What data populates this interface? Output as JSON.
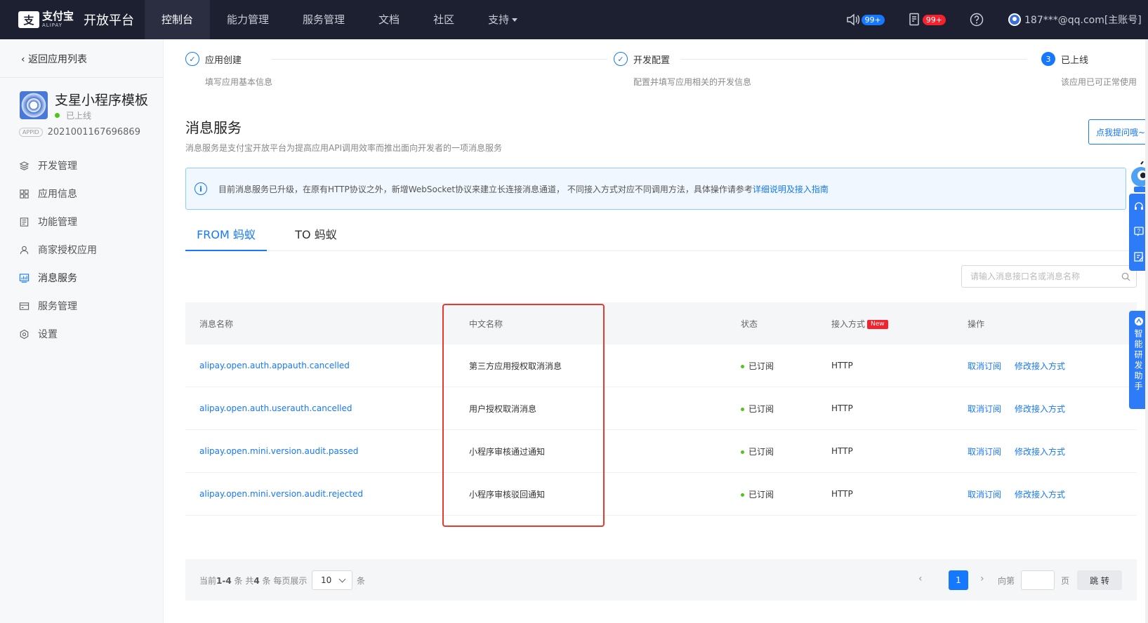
{
  "header": {
    "logo_mark": "支",
    "logo_cn": "支付宝",
    "logo_en": "ALIPAY",
    "platform_title": "开放平台",
    "nav": [
      {
        "label": "控制台",
        "active": true
      },
      {
        "label": "能力管理"
      },
      {
        "label": "服务管理"
      },
      {
        "label": "文档"
      },
      {
        "label": "社区"
      },
      {
        "label": "支持"
      }
    ],
    "notice_badge": "99+",
    "message_badge": "99+",
    "account": "187***@qq.com[主账号]"
  },
  "sidebar": {
    "back_label": "返回应用列表",
    "app_name": "支星小程序模板",
    "app_status": "已上线",
    "appid_tag": "APPID",
    "appid_value": "2021001167696869",
    "items": [
      {
        "label": "开发管理",
        "icon": "layers-icon"
      },
      {
        "label": "应用信息",
        "icon": "grid-icon"
      },
      {
        "label": "功能管理",
        "icon": "doc-icon"
      },
      {
        "label": "商家授权应用",
        "icon": "user-icon"
      },
      {
        "label": "消息服务",
        "icon": "chart-icon",
        "active": true
      },
      {
        "label": "服务管理",
        "icon": "card-icon"
      },
      {
        "label": "设置",
        "icon": "gear-icon"
      }
    ]
  },
  "steps": [
    {
      "title": "应用创建",
      "desc": "填写应用基本信息",
      "state": "done"
    },
    {
      "title": "开发配置",
      "desc": "配置并填写应用相关的开发信息",
      "state": "done"
    },
    {
      "number": "3",
      "title": "已上线",
      "desc": "该应用已可正常使用",
      "state": "current"
    }
  ],
  "page": {
    "title": "消息服务",
    "desc": "消息服务是支付宝开放平台为提高应用API调用效率而推出面向开发者的一项消息服务"
  },
  "alert": {
    "text": "目前消息服务已升级，在原有HTTP协议之外，新增WebSocket协议来建立长连接消息通道， 不同接入方式对应不同调用方法，具体操作请参考",
    "link": "详细说明及接入指南"
  },
  "tabs": [
    {
      "label": "FROM 蚂蚁",
      "active": true
    },
    {
      "label": "TO 蚂蚁"
    }
  ],
  "search": {
    "placeholder": "请输入消息接口名或消息名称",
    "value": ""
  },
  "table": {
    "columns": [
      "消息名称",
      "中文名称",
      "状态",
      "接入方式",
      "操作"
    ],
    "new_tag": "New",
    "rows": [
      {
        "name": "alipay.open.auth.appauth.cancelled",
        "cn": "第三方应用授权取消消息",
        "status": "已订阅",
        "method": "HTTP",
        "op1": "取消订阅",
        "op2": "修改接入方式"
      },
      {
        "name": "alipay.open.auth.userauth.cancelled",
        "cn": "用户授权取消消息",
        "status": "已订阅",
        "method": "HTTP",
        "op1": "取消订阅",
        "op2": "修改接入方式"
      },
      {
        "name": "alipay.open.mini.version.audit.passed",
        "cn": "小程序审核通过通知",
        "status": "已订阅",
        "method": "HTTP",
        "op1": "取消订阅",
        "op2": "修改接入方式"
      },
      {
        "name": "alipay.open.mini.version.audit.rejected",
        "cn": "小程序审核驳回通知",
        "status": "已订阅",
        "method": "HTTP",
        "op1": "取消订阅",
        "op2": "修改接入方式"
      }
    ]
  },
  "pager": {
    "prefix": "当前",
    "range": "1-4",
    "mid": "条 共",
    "total": "4",
    "suffix": "条  每页展示",
    "page_size": "10",
    "unit": "条",
    "current": "1",
    "goto_label": "向第",
    "page_label": "页",
    "jump_label": "跳 转"
  },
  "widgets": {
    "ask_label": "点我提问哦~",
    "assistant_label": "智能研发助手"
  },
  "colors": {
    "primary": "#1677ff",
    "nav_bg": "#1d2030",
    "highlight": "#e8392f",
    "success": "#52c41a"
  }
}
